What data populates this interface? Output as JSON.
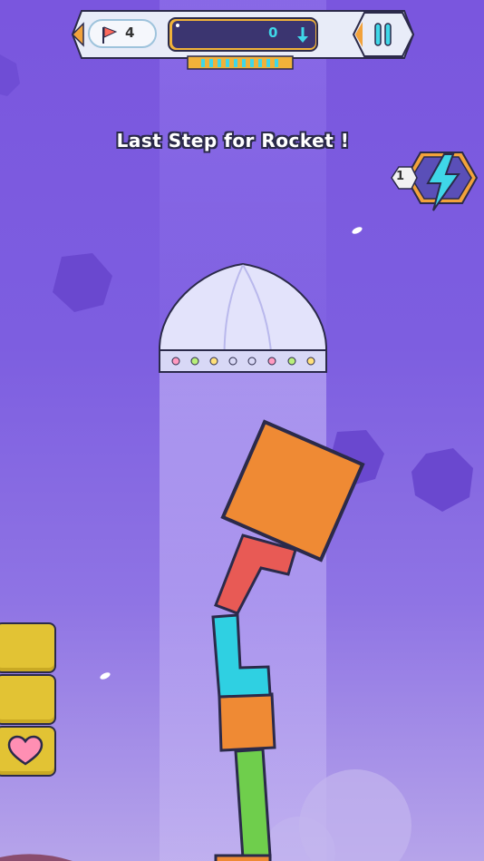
{
  "hud": {
    "flag_count": "4",
    "depth_value": "0",
    "flag_icon": "flag-icon",
    "depth_icon": "down-arrow-icon",
    "pause_icon": "pause-icon"
  },
  "message": "Last Step for Rocket !",
  "boost": {
    "count": "1",
    "icon": "lightning-icon"
  },
  "side_buttons": [
    {
      "name": "side-button-1",
      "icon": ""
    },
    {
      "name": "side-button-2",
      "icon": ""
    },
    {
      "name": "life-button",
      "icon": "heart-icon"
    }
  ],
  "colors": {
    "sky_top": "#7a56de",
    "sky_bottom": "#b6a4ea",
    "block_orange": "#ef8a34",
    "block_red": "#e85a55",
    "block_cyan": "#2fd0e2",
    "block_green": "#6fce4c",
    "button_yellow": "#e2c334",
    "heart_pink": "#ff8fb3"
  }
}
